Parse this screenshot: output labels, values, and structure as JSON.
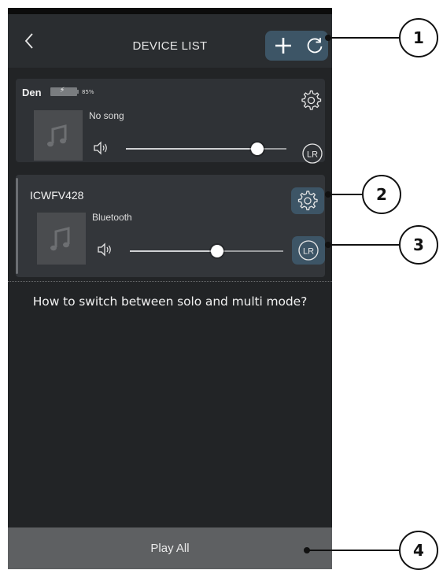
{
  "header": {
    "title": "DEVICE LIST",
    "back_icon": "chevron-left-icon",
    "add_icon": "plus-icon",
    "refresh_icon": "refresh-icon",
    "button_group_color": "#3d5566"
  },
  "devices": [
    {
      "name": "Den",
      "battery_percent": "85%",
      "song": "No song",
      "volume": 0.82,
      "selected": false,
      "settings_icon": "gear-icon",
      "channel_label": "LR"
    },
    {
      "name": "ICWFV428",
      "song": "Bluetooth",
      "volume": 0.57,
      "selected": true,
      "settings_icon": "gear-icon",
      "channel_label": "LR"
    }
  ],
  "help": {
    "question": "How to switch between solo and multi mode?"
  },
  "footer": {
    "play_all_label": "Play All"
  },
  "callouts": [
    "1",
    "2",
    "3",
    "4"
  ]
}
